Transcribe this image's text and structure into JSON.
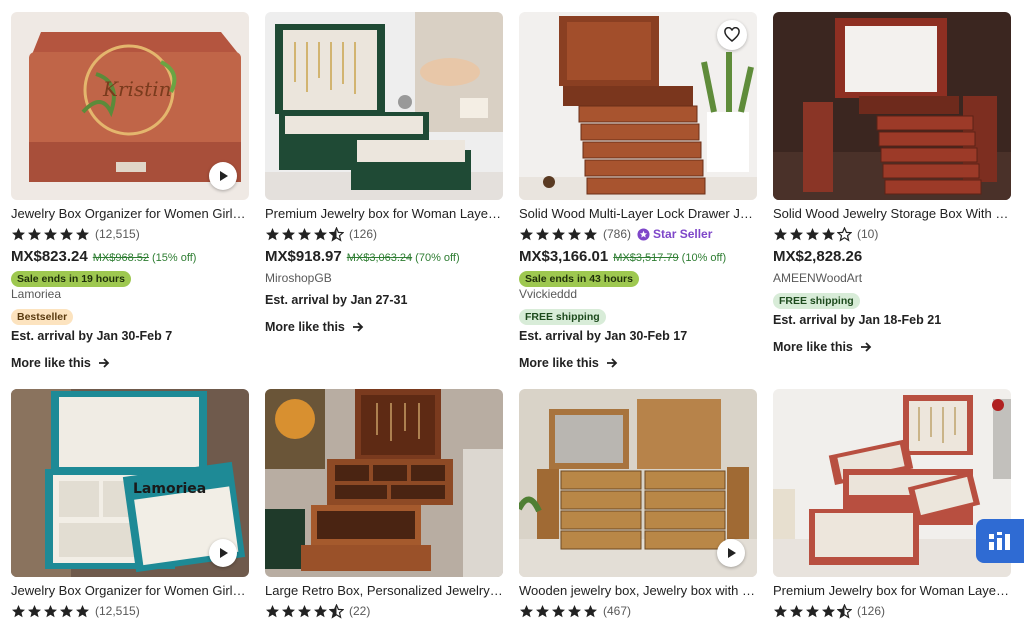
{
  "listings": [
    {
      "title": "Jewelry Box Organizer for Women Girls, Personalized",
      "rating": 5,
      "reviews": "(12,515)",
      "price": "MX$823.24",
      "original_price": "MX$968.52",
      "discount": "(15% off)",
      "sale_badge": "Sale ends in 19 hours",
      "shop": "Lamoriea",
      "bestseller": "Bestseller",
      "arrival": "Est. arrival by Jan 30-Feb 7",
      "more": "More like this",
      "has_video": true,
      "heart": false,
      "image": "red-leather-box-monogram-icon",
      "image_text": "Kristin"
    },
    {
      "title": "Premium Jewelry box for Woman Layered Organizer",
      "rating": 4.5,
      "reviews": "(126)",
      "price": "MX$918.97",
      "original_price": "MX$3,063.24",
      "discount": "(70% off)",
      "shop": "MiroshopGB",
      "arrival": "Est. arrival by Jan 27-31",
      "more": "More like this",
      "image": "green-jewelry-box-icon"
    },
    {
      "title": "Solid Wood Multi-Layer Lock Drawer Jewelry Box",
      "rating": 5,
      "reviews": "(786)",
      "star_seller": "Star Seller",
      "price": "MX$3,166.01",
      "original_price": "MX$3,517.79",
      "discount": "(10% off)",
      "sale_badge": "Sale ends in 43 hours",
      "shop": "Vvickieddd",
      "free_shipping": "FREE shipping",
      "arrival": "Est. arrival by Jan 30-Feb 17",
      "more": "More like this",
      "heart": true,
      "image": "wood-drawer-box-icon"
    },
    {
      "title": "Solid Wood Jewelry Storage Box With Mirror",
      "rating": 4,
      "reviews": "(10)",
      "price": "MX$2,828.26",
      "shop": "AMEENWoodArt",
      "free_shipping": "FREE shipping",
      "arrival": "Est. arrival by Jan 18-Feb 21",
      "more": "More like this",
      "image": "wood-armoire-box-icon"
    },
    {
      "title": "Jewelry Box Organizer for Women Girls, Personalized",
      "rating": 5,
      "reviews": "(12,515)",
      "has_video": true,
      "image": "teal-jewelry-box-icon",
      "image_text": "Lamoriea"
    },
    {
      "title": "Large Retro Box, Personalized Jewelry Box",
      "rating": 4.5,
      "reviews": "(22)",
      "image": "retro-wood-box-icon"
    },
    {
      "title": "Wooden jewelry box, Jewelry box with mirror",
      "rating": 5,
      "reviews": "(467)",
      "has_video": true,
      "image": "light-wood-box-icon"
    },
    {
      "title": "Premium Jewelry box for Woman Layered Organizer",
      "rating": 4.5,
      "reviews": "(126)",
      "image": "red-open-box-icon"
    }
  ],
  "icons": {
    "play": "play-icon",
    "heart": "heart-icon",
    "arrow": "arrow-right-icon",
    "widget": "chart-widget-icon"
  },
  "colors": {
    "star": "#222222",
    "discount": "#2e7d32",
    "star_seller": "#7e46c9",
    "sale_badge": "#9ec850",
    "widget": "#2f6bd3"
  }
}
